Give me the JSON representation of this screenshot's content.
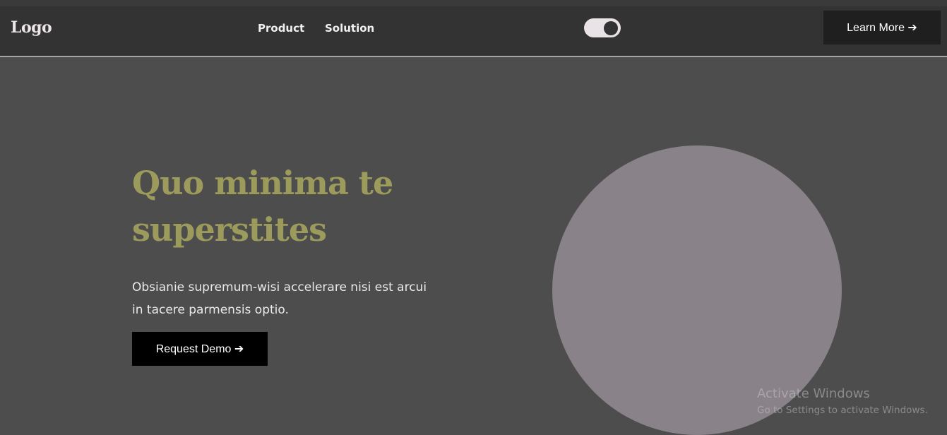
{
  "nav": {
    "logo": "Logo",
    "links": [
      {
        "label": "Product"
      },
      {
        "label": "Solution"
      }
    ],
    "theme_toggle": {
      "state": "on"
    },
    "cta_label": "Learn More ➔"
  },
  "hero": {
    "title": "Quo minima te superstites",
    "description": "Obsianie supremum-wisi accelerare nisi est arcui in tacere parmensis optio.",
    "button_label": "Request Demo ➔"
  },
  "watermark": {
    "title": "Activate Windows",
    "subtitle": "Go to Settings to activate Windows."
  },
  "colors": {
    "page_background": "#4d4d4d",
    "navbar_background": "#333333",
    "title_accent": "#9c9b5b",
    "circle_fill": "#898288",
    "button_background": "#000000"
  }
}
